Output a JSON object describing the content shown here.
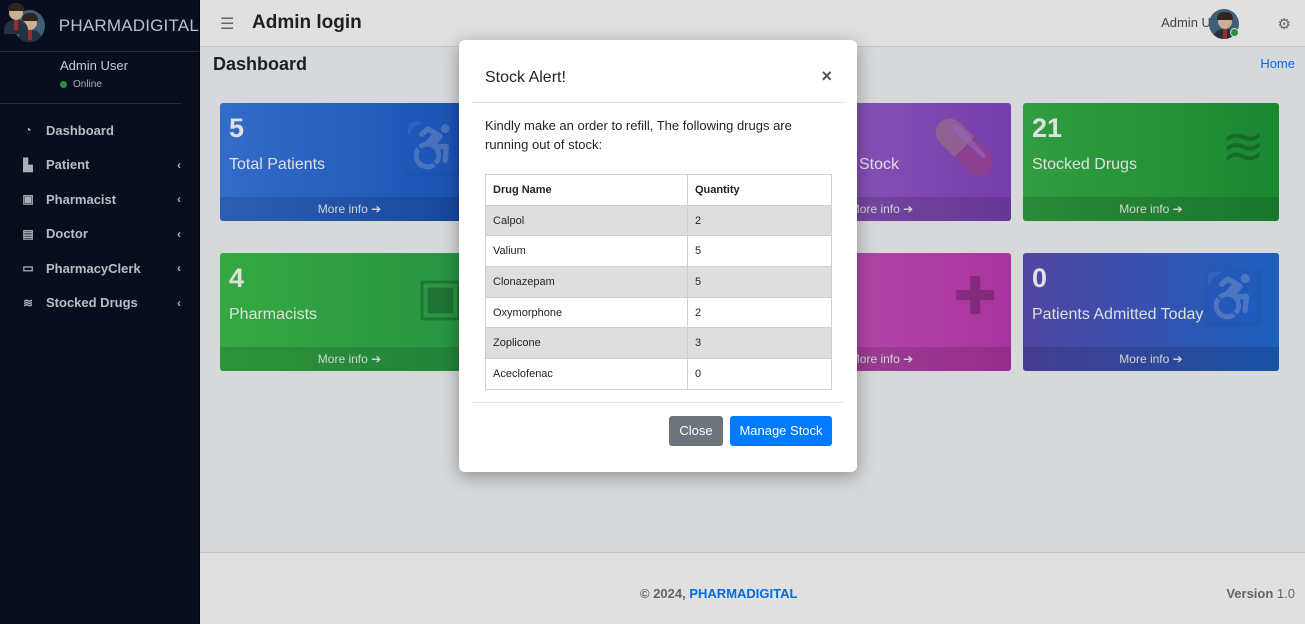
{
  "brand": "PHARMADIGITAL",
  "sidebar": {
    "user_name": "Admin User",
    "user_status": "Online",
    "items": [
      {
        "label": "Dashboard",
        "icon": "dashboard-icon"
      },
      {
        "label": "Patient",
        "icon": "users-icon"
      },
      {
        "label": "Pharmacist",
        "icon": "id-card-icon"
      },
      {
        "label": "Doctor",
        "icon": "medkit-icon"
      },
      {
        "label": "PharmacyClerk",
        "icon": "desktop-icon"
      },
      {
        "label": "Stocked Drugs",
        "icon": "layers-icon"
      }
    ]
  },
  "header": {
    "title": "Admin login",
    "user": "Admin User"
  },
  "content": {
    "heading": "Dashboard",
    "breadcrumb": "Home"
  },
  "boxes": [
    {
      "value": "5",
      "label": "Total Patients",
      "more": "More info ➔"
    },
    {
      "value": "",
      "label": "Stock",
      "more": "More info ➔"
    },
    {
      "value": "21",
      "label": "Stocked Drugs",
      "more": "More info ➔"
    },
    {
      "value": "4",
      "label": "Pharmacists",
      "more": "More info ➔"
    },
    {
      "value": "",
      "label": "",
      "more": "More info ➔"
    },
    {
      "value": "0",
      "label": "Patients Admitted Today",
      "more": "More info ➔"
    }
  ],
  "footer": {
    "copyright": "© 2024,",
    "brand": "PHARMADIGITAL",
    "version_label": "Version",
    "version": "1.0"
  },
  "modal": {
    "title": "Stock Alert!",
    "close_symbol": "×",
    "message": "Kindly make an order to refill, The following drugs are running out of stock:",
    "columns": [
      "Drug Name",
      "Quantity"
    ],
    "rows": [
      [
        "Calpol",
        "2"
      ],
      [
        "Valium",
        "5"
      ],
      [
        "Clonazepam",
        "5"
      ],
      [
        "Oxymorphone",
        "2"
      ],
      [
        "Zoplicone",
        "3"
      ],
      [
        "Aceclofenac",
        "0"
      ]
    ],
    "close_button": "Close",
    "manage_button": "Manage Stock"
  }
}
